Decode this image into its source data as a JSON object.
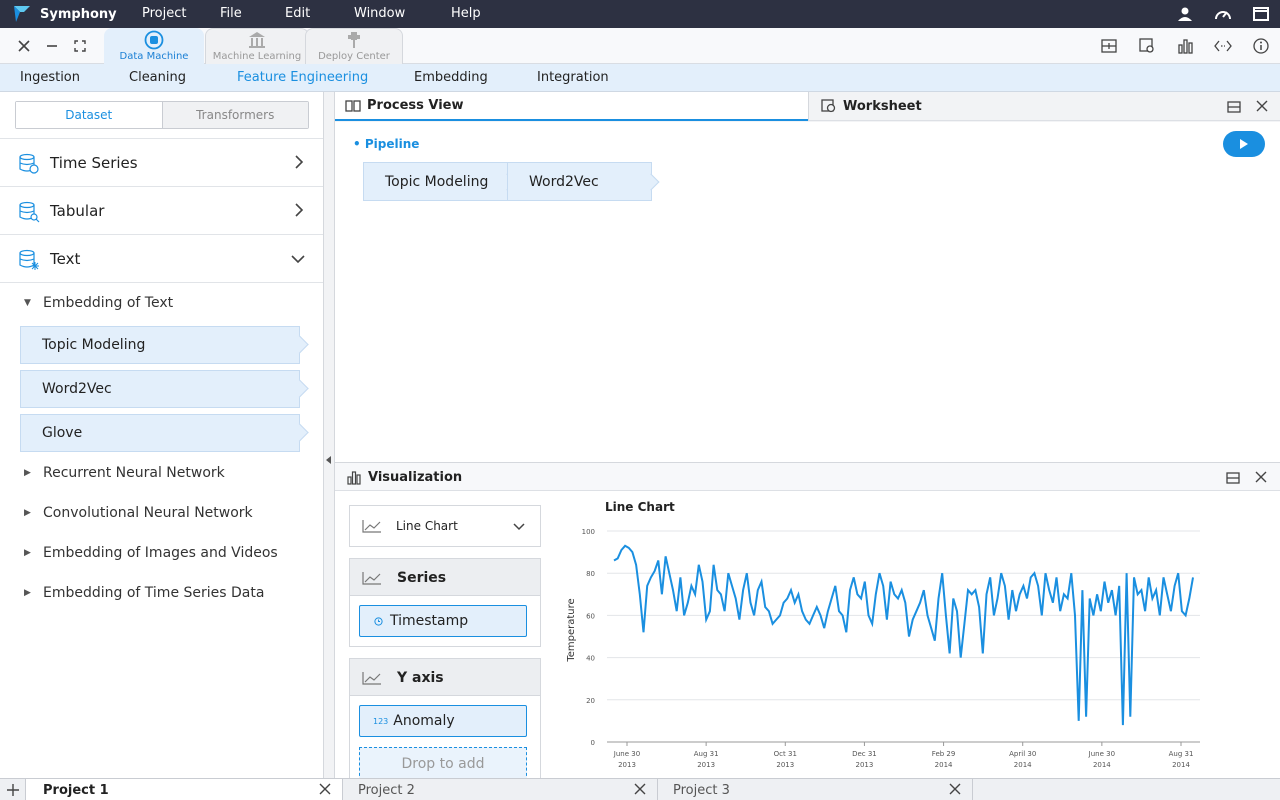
{
  "app": {
    "name": "Symphony"
  },
  "menu": [
    "Project",
    "File",
    "Edit",
    "Window",
    "Help"
  ],
  "menu_right_icons": [
    "user-icon",
    "gauge-icon",
    "window-icon"
  ],
  "app_tabs": [
    {
      "label": "Data Machine",
      "icon": "data-machine-icon",
      "active": true
    },
    {
      "label": "Machine Learning",
      "icon": "bank-icon",
      "active": false
    },
    {
      "label": "Deploy Center",
      "icon": "deploy-icon",
      "active": false
    }
  ],
  "toolbar_right_icons": [
    "form-icon",
    "preview-icon",
    "bar-chart-icon",
    "code-icon",
    "info-icon"
  ],
  "subnav": [
    "Ingestion",
    "Cleaning",
    "Feature Engineering",
    "Embedding",
    "Integration"
  ],
  "subnav_active": "Feature Engineering",
  "sidebar": {
    "segments": [
      "Dataset",
      "Transformers"
    ],
    "categories": [
      "Time Series",
      "Tabular",
      "Text"
    ],
    "groups": {
      "embedding_text": "Embedding of Text",
      "rnn": "Recurrent Neural Network",
      "cnn": "Convolutional Neural Network",
      "images": "Embedding of Images and Videos",
      "timeseries": "Embedding of Time Series Data"
    },
    "leaves": [
      "Topic Modeling",
      "Word2Vec",
      "Glove"
    ]
  },
  "process_view": {
    "title": "Process View",
    "worksheet": "Worksheet",
    "pipeline_label": "Pipeline",
    "steps": [
      "Topic Modeling",
      "Word2Vec"
    ]
  },
  "visualization": {
    "title": "Visualization",
    "chart_type_select": "Line Chart",
    "series_header": "Series",
    "series_chip": "Timestamp",
    "y_header": "Y axis",
    "y_chip_prefix": "123",
    "y_chip": "Anomaly",
    "drop_placeholder": "Drop to add"
  },
  "chart_data": {
    "type": "line",
    "title": "Line Chart",
    "ylabel": "Temperature",
    "xlabel": "",
    "ylim": [
      0,
      100
    ],
    "yticks": [
      0,
      20,
      40,
      60,
      80,
      100
    ],
    "xticks": [
      {
        "label": "June 30",
        "year": "2013"
      },
      {
        "label": "Aug 31",
        "year": "2013"
      },
      {
        "label": "Oct 31",
        "year": "2013"
      },
      {
        "label": "Dec 31",
        "year": "2013"
      },
      {
        "label": "Feb 29",
        "year": "2014"
      },
      {
        "label": "April 30",
        "year": "2014"
      },
      {
        "label": "June 30",
        "year": "2014"
      },
      {
        "label": "Aug 31",
        "year": "2014"
      }
    ],
    "color": "#1a8fe0",
    "series": [
      {
        "values": [
          86,
          87,
          91,
          93,
          92,
          90,
          84,
          70,
          52,
          74,
          78,
          81,
          86,
          70,
          88,
          80,
          72,
          62,
          78,
          60,
          66,
          74,
          70,
          84,
          76,
          58,
          62,
          84,
          72,
          70,
          62,
          80,
          74,
          68,
          58,
          72,
          80,
          66,
          60,
          72,
          76,
          64,
          62,
          56,
          58,
          60,
          66,
          68,
          72,
          66,
          70,
          62,
          58,
          56,
          60,
          64,
          60,
          54,
          62,
          68,
          74,
          62,
          60,
          52,
          72,
          78,
          70,
          68,
          76,
          60,
          56,
          70,
          80,
          74,
          58,
          76,
          70,
          68,
          72,
          66,
          50,
          58,
          62,
          66,
          72,
          60,
          54,
          48,
          68,
          80,
          60,
          42,
          68,
          62,
          40,
          56,
          72,
          70,
          72,
          64,
          42,
          70,
          78,
          60,
          68,
          80,
          74,
          58,
          72,
          62,
          70,
          74,
          68,
          78,
          80,
          74,
          60,
          80,
          72,
          66,
          78,
          62,
          70,
          68,
          80,
          60,
          10,
          72,
          12,
          68,
          60,
          70,
          62,
          76,
          66,
          72,
          60,
          74,
          8,
          80,
          12,
          78,
          70,
          72,
          62,
          78,
          68,
          72,
          60,
          78,
          70,
          62,
          74,
          80,
          62,
          60,
          68,
          78
        ]
      }
    ]
  },
  "bottom_tabs": [
    "Project 1",
    "Project 2",
    "Project 3"
  ]
}
